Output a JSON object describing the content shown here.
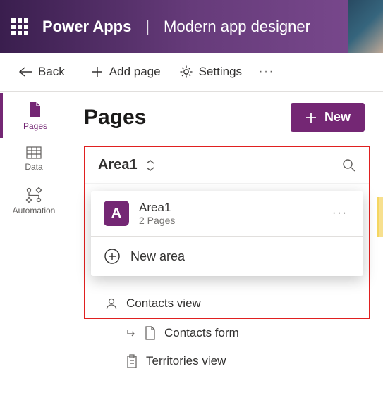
{
  "header": {
    "app": "Power Apps",
    "divider": "|",
    "sub": "Modern app designer"
  },
  "toolbar": {
    "back": "Back",
    "addPage": "Add page",
    "settings": "Settings"
  },
  "rail": {
    "pages": "Pages",
    "data": "Data",
    "automation": "Automation"
  },
  "main": {
    "title": "Pages",
    "newBtn": "New"
  },
  "areaHeader": "Area1",
  "popup": {
    "badge": "A",
    "title": "Area1",
    "sub": "2 Pages",
    "newArea": "New area"
  },
  "tree": {
    "contactsView": "Contacts view",
    "contactsForm": "Contacts form",
    "territoriesView": "Territories view"
  }
}
